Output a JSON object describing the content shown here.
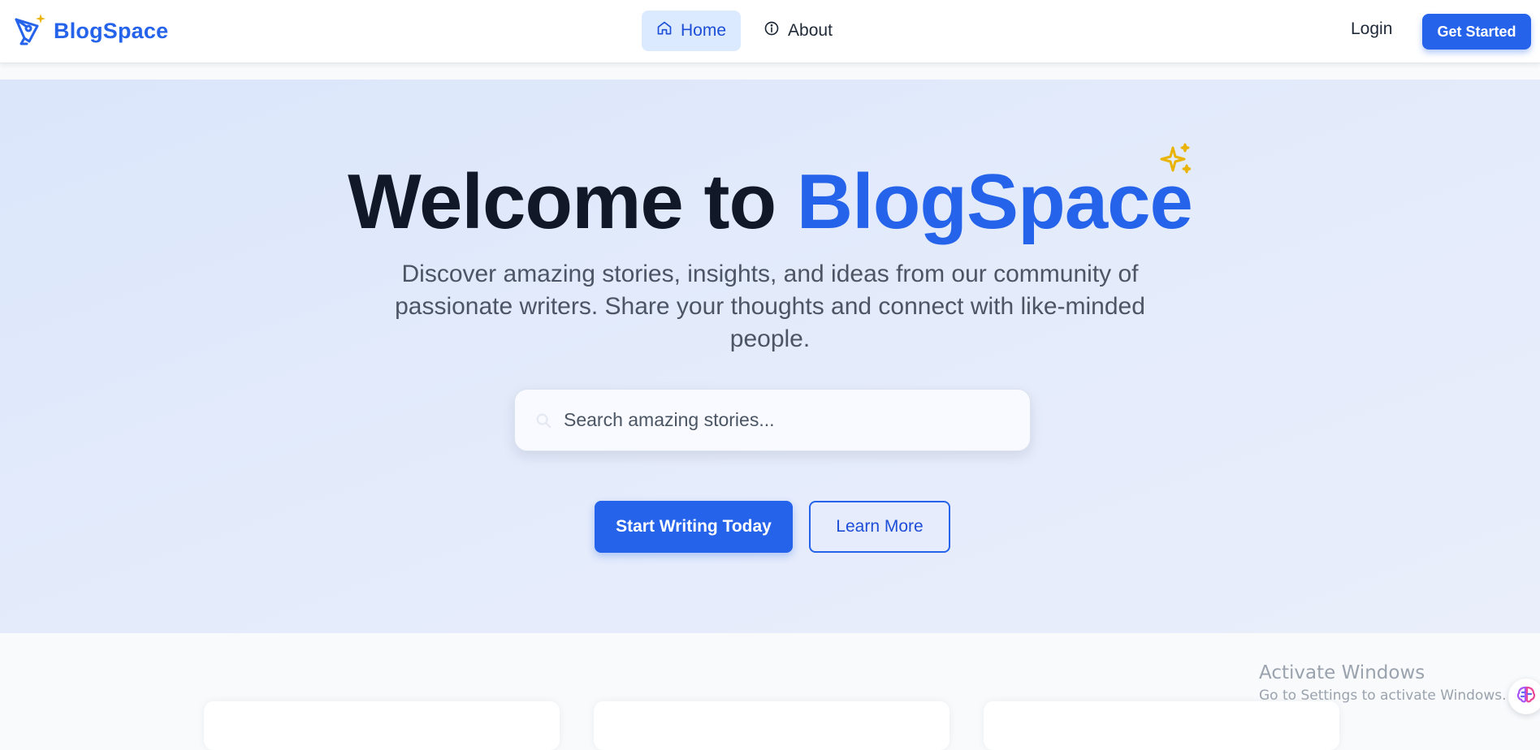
{
  "header": {
    "brand": "BlogSpace",
    "nav": [
      {
        "label": "Home",
        "icon": "home-icon",
        "active": true
      },
      {
        "label": "About",
        "icon": "info-icon",
        "active": false
      }
    ],
    "login_label": "Login",
    "get_started_label": "Get Started"
  },
  "hero": {
    "title_prefix": "Welcome to",
    "title_accent": "BlogSpace",
    "subtitle": "Discover amazing stories, insights, and ideas from our community of passionate writers. Share your thoughts and connect with like-minded people.",
    "search": {
      "placeholder": "Search amazing stories...",
      "value": ""
    },
    "primary_cta": "Start Writing Today",
    "secondary_cta": "Learn More"
  },
  "watermark": {
    "title": "Activate Windows",
    "subtitle": "Go to Settings to activate Windows."
  },
  "colors": {
    "brand": "#2563eb",
    "sparkle": "#eab308",
    "text_dark": "#111827",
    "text_muted": "#4b5563"
  }
}
